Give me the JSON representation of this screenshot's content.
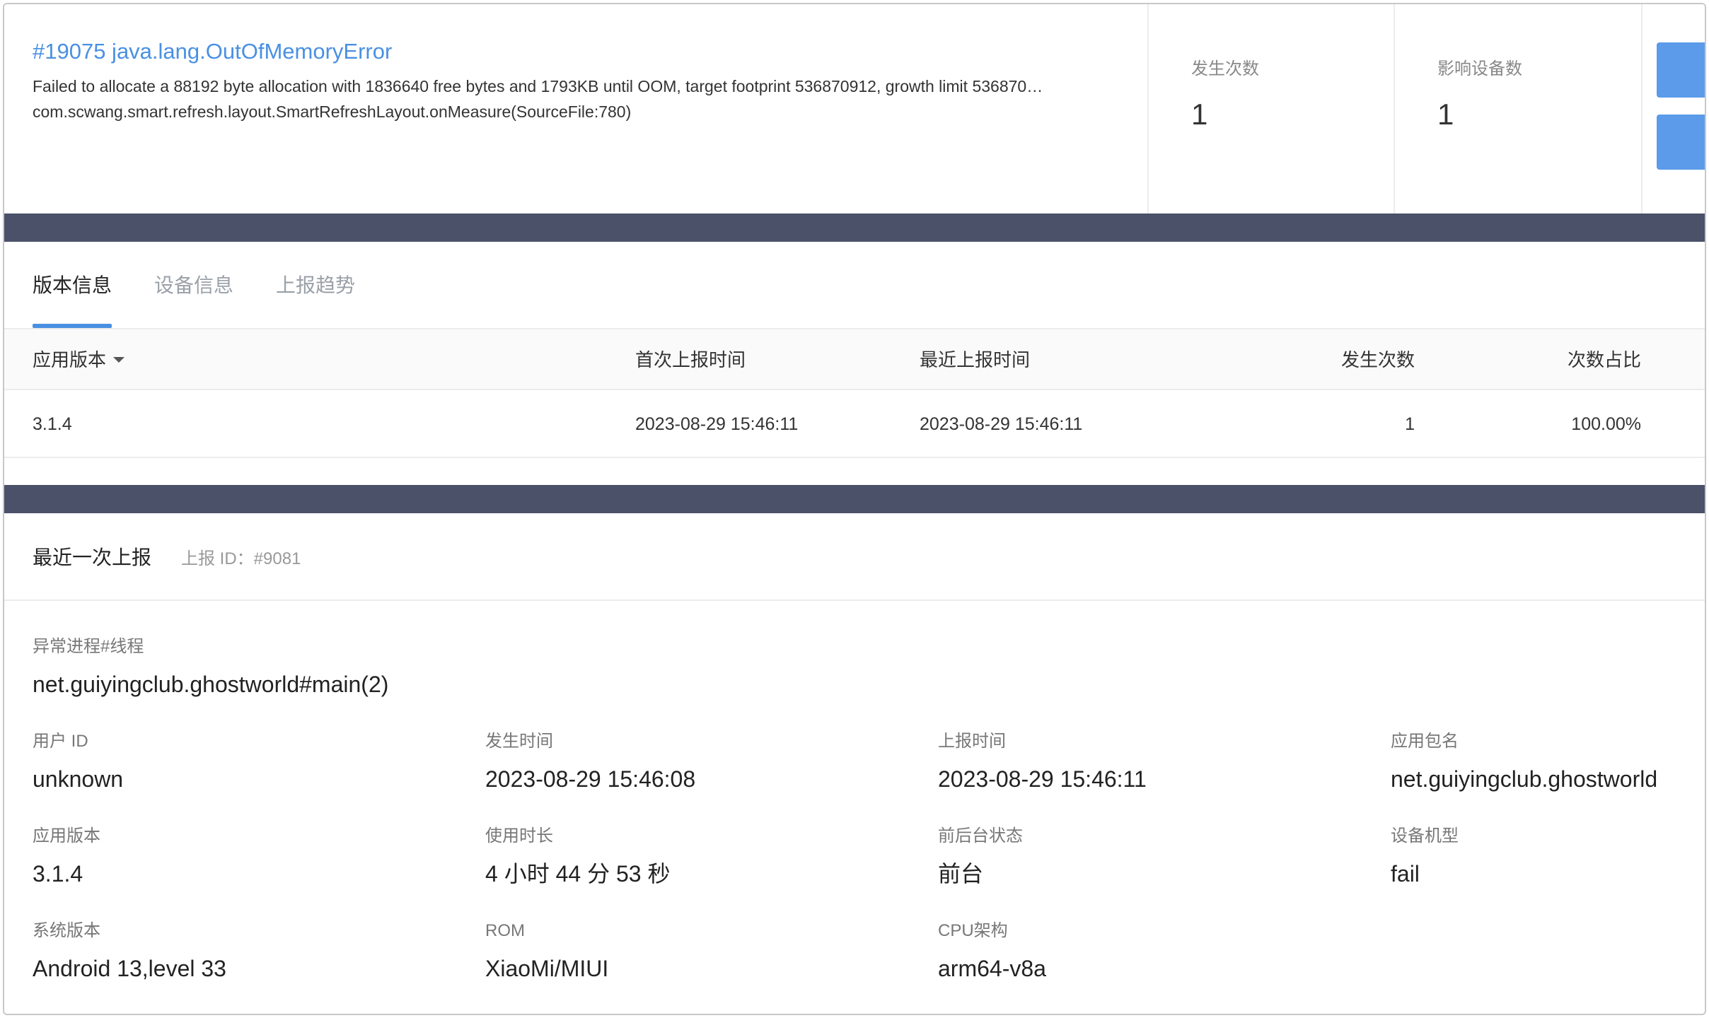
{
  "issue": {
    "title": "#19075 java.lang.OutOfMemoryError",
    "message": "Failed to allocate a 88192 byte allocation with 1836640 free bytes and 1793KB until OOM, target footprint 536870912, growth limit 536870…",
    "frame": "com.scwang.smart.refresh.layout.SmartRefreshLayout.onMeasure(SourceFile:780)"
  },
  "stats": {
    "occurrences_label": "发生次数",
    "occurrences_value": "1",
    "devices_label": "影响设备数",
    "devices_value": "1"
  },
  "tabs": [
    {
      "label": "版本信息",
      "active": true
    },
    {
      "label": "设备信息",
      "active": false
    },
    {
      "label": "上报趋势",
      "active": false
    }
  ],
  "version_table": {
    "columns": [
      "应用版本",
      "首次上报时间",
      "最近上报时间",
      "发生次数",
      "次数占比"
    ],
    "rows": [
      [
        "3.1.4",
        "2023-08-29 15:46:11",
        "2023-08-29 15:46:11",
        "1",
        "100.00%"
      ]
    ]
  },
  "latest": {
    "title": "最近一次上报",
    "report_id": "上报 ID：#9081",
    "fields": {
      "process_thread": {
        "label": "异常进程#线程",
        "value": "net.guiyingclub.ghostworld#main(2)"
      },
      "user_id": {
        "label": "用户 ID",
        "value": "unknown"
      },
      "occur_time": {
        "label": "发生时间",
        "value": "2023-08-29 15:46:08"
      },
      "report_time": {
        "label": "上报时间",
        "value": "2023-08-29 15:46:11"
      },
      "package": {
        "label": "应用包名",
        "value": "net.guiyingclub.ghostworld"
      },
      "app_version": {
        "label": "应用版本",
        "value": "3.1.4"
      },
      "usage_duration": {
        "label": "使用时长",
        "value": "4 小时 44 分 53 秒"
      },
      "fg_bg_state": {
        "label": "前后台状态",
        "value": "前台"
      },
      "device_model": {
        "label": "设备机型",
        "value": "fail"
      },
      "os_version": {
        "label": "系统版本",
        "value": "Android 13,level 33"
      },
      "rom": {
        "label": "ROM",
        "value": "XiaoMi/MIUI"
      },
      "cpu_arch": {
        "label": "CPU架构",
        "value": "arm64-v8a"
      }
    }
  },
  "colors": {
    "accent": "#4a90e2",
    "band": "#4b5168",
    "side_button": "#5b9bea"
  }
}
